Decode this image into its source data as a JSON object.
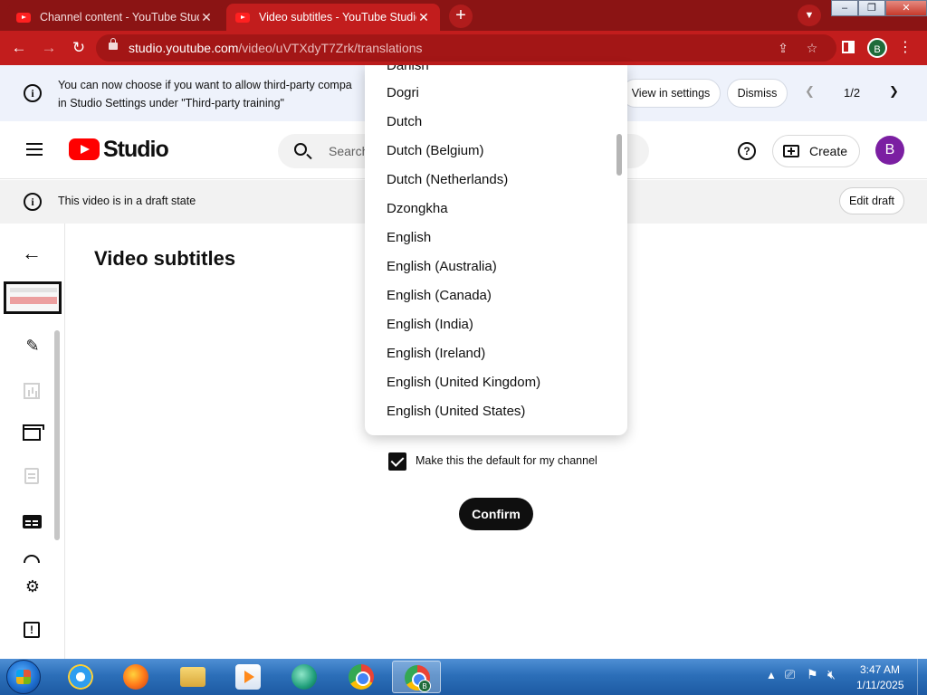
{
  "browser": {
    "tabs": [
      {
        "title": "Channel content - YouTube Studio",
        "active": false
      },
      {
        "title": "Video subtitles - YouTube Studio",
        "active": true
      }
    ],
    "new_tab": "+",
    "url_host": "studio.youtube.com",
    "url_path": "/video/uVTXdyT7Zrk/translations",
    "profile_initial": "B"
  },
  "notice": {
    "line1": "You can now choose if you want to allow third-party compa",
    "line2": "in Studio Settings under \"Third-party training\"",
    "view_settings": "View in settings",
    "dismiss": "Dismiss",
    "pager": "1/2"
  },
  "header": {
    "brand": "Studio",
    "search_placeholder": "Search",
    "create": "Create",
    "avatar_initial": "B"
  },
  "draft": {
    "text": "This video is in a draft state",
    "edit": "Edit draft"
  },
  "main": {
    "title": "Video subtitles",
    "checkbox_label": "Make this the default for my channel",
    "checkbox_checked": true,
    "confirm": "Confirm"
  },
  "dropdown": {
    "items": [
      "Danish",
      "Dogri",
      "Dutch",
      "Dutch (Belgium)",
      "Dutch (Netherlands)",
      "Dzongkha",
      "English",
      "English (Australia)",
      "English (Canada)",
      "English (India)",
      "English (Ireland)",
      "English (United Kingdom)",
      "English (United States)"
    ]
  },
  "taskbar": {
    "time": "3:47 AM",
    "date": "1/11/2025",
    "chrome_badge": "B"
  },
  "colors": {
    "browser_frame": "#8b1414",
    "browser_toolbar": "#c21d1d",
    "youtube_red": "#ff0000",
    "avatar": "#7b1fa2",
    "notice_bg": "#eef2fb"
  }
}
